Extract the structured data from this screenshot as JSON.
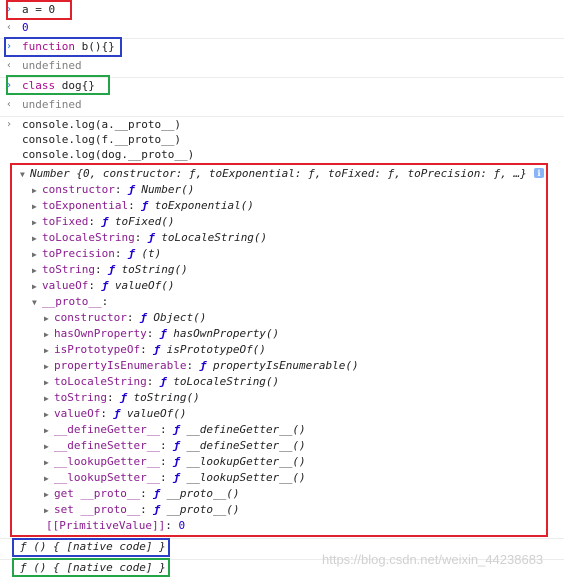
{
  "console": {
    "entry1": {
      "input_code": "a = 0",
      "output": "0"
    },
    "entry2": {
      "input_kw": "function",
      "input_rest": " b(){}",
      "output": "undefined"
    },
    "entry3": {
      "input_kw": "class",
      "input_rest": " dog{}",
      "output": "undefined"
    },
    "entry4": {
      "lines": [
        "console.log(a.__proto__)",
        "console.log(f.__proto__)",
        "console.log(dog.__proto__)"
      ]
    }
  },
  "number_object": {
    "header_name": "Number",
    "header_preview": " {0, constructor: ƒ, toExponential: ƒ, toFixed: ƒ, toPrecision: ƒ, …}",
    "props": [
      {
        "key": "constructor",
        "val": "Number()"
      },
      {
        "key": "toExponential",
        "val": "toExponential()"
      },
      {
        "key": "toFixed",
        "val": "toFixed()"
      },
      {
        "key": "toLocaleString",
        "val": "toLocaleString()"
      },
      {
        "key": "toPrecision",
        "val": "(t)"
      },
      {
        "key": "toString",
        "val": "toString()"
      },
      {
        "key": "valueOf",
        "val": "valueOf()"
      }
    ],
    "proto_label": "__proto__",
    "proto_props": [
      {
        "key": "constructor",
        "val": "Object()"
      },
      {
        "key": "hasOwnProperty",
        "val": "hasOwnProperty()"
      },
      {
        "key": "isPrototypeOf",
        "val": "isPrototypeOf()"
      },
      {
        "key": "propertyIsEnumerable",
        "val": "propertyIsEnumerable()"
      },
      {
        "key": "toLocaleString",
        "val": "toLocaleString()"
      },
      {
        "key": "toString",
        "val": "toString()"
      },
      {
        "key": "valueOf",
        "val": "valueOf()"
      },
      {
        "key": "__defineGetter__",
        "val": "__defineGetter__()"
      },
      {
        "key": "__defineSetter__",
        "val": "__defineSetter__()"
      },
      {
        "key": "__lookupGetter__",
        "val": "__lookupGetter__()"
      },
      {
        "key": "__lookupSetter__",
        "val": "__lookupSetter__()"
      },
      {
        "key": "get __proto__",
        "val": "__proto__()"
      },
      {
        "key": "set __proto__",
        "val": "__proto__()"
      }
    ],
    "primitive_key": "[[PrimitiveValue]]",
    "primitive_val": "0"
  },
  "native_outputs": [
    "ƒ () { [native code] }",
    "ƒ () { [native code] }"
  ],
  "watermark": "https://blog.csdn.net/weixin_44238683",
  "glyphs": {
    "prompt": "›",
    "result": "‹",
    "expanded": "▼",
    "collapsed": "▶",
    "f": "ƒ",
    "info": "i"
  },
  "colors": {
    "red_box": "#e0202a",
    "blue_box": "#2b3fc7",
    "green_box": "#22a447",
    "key": "#8a1c8f",
    "number": "#1c00cf"
  }
}
